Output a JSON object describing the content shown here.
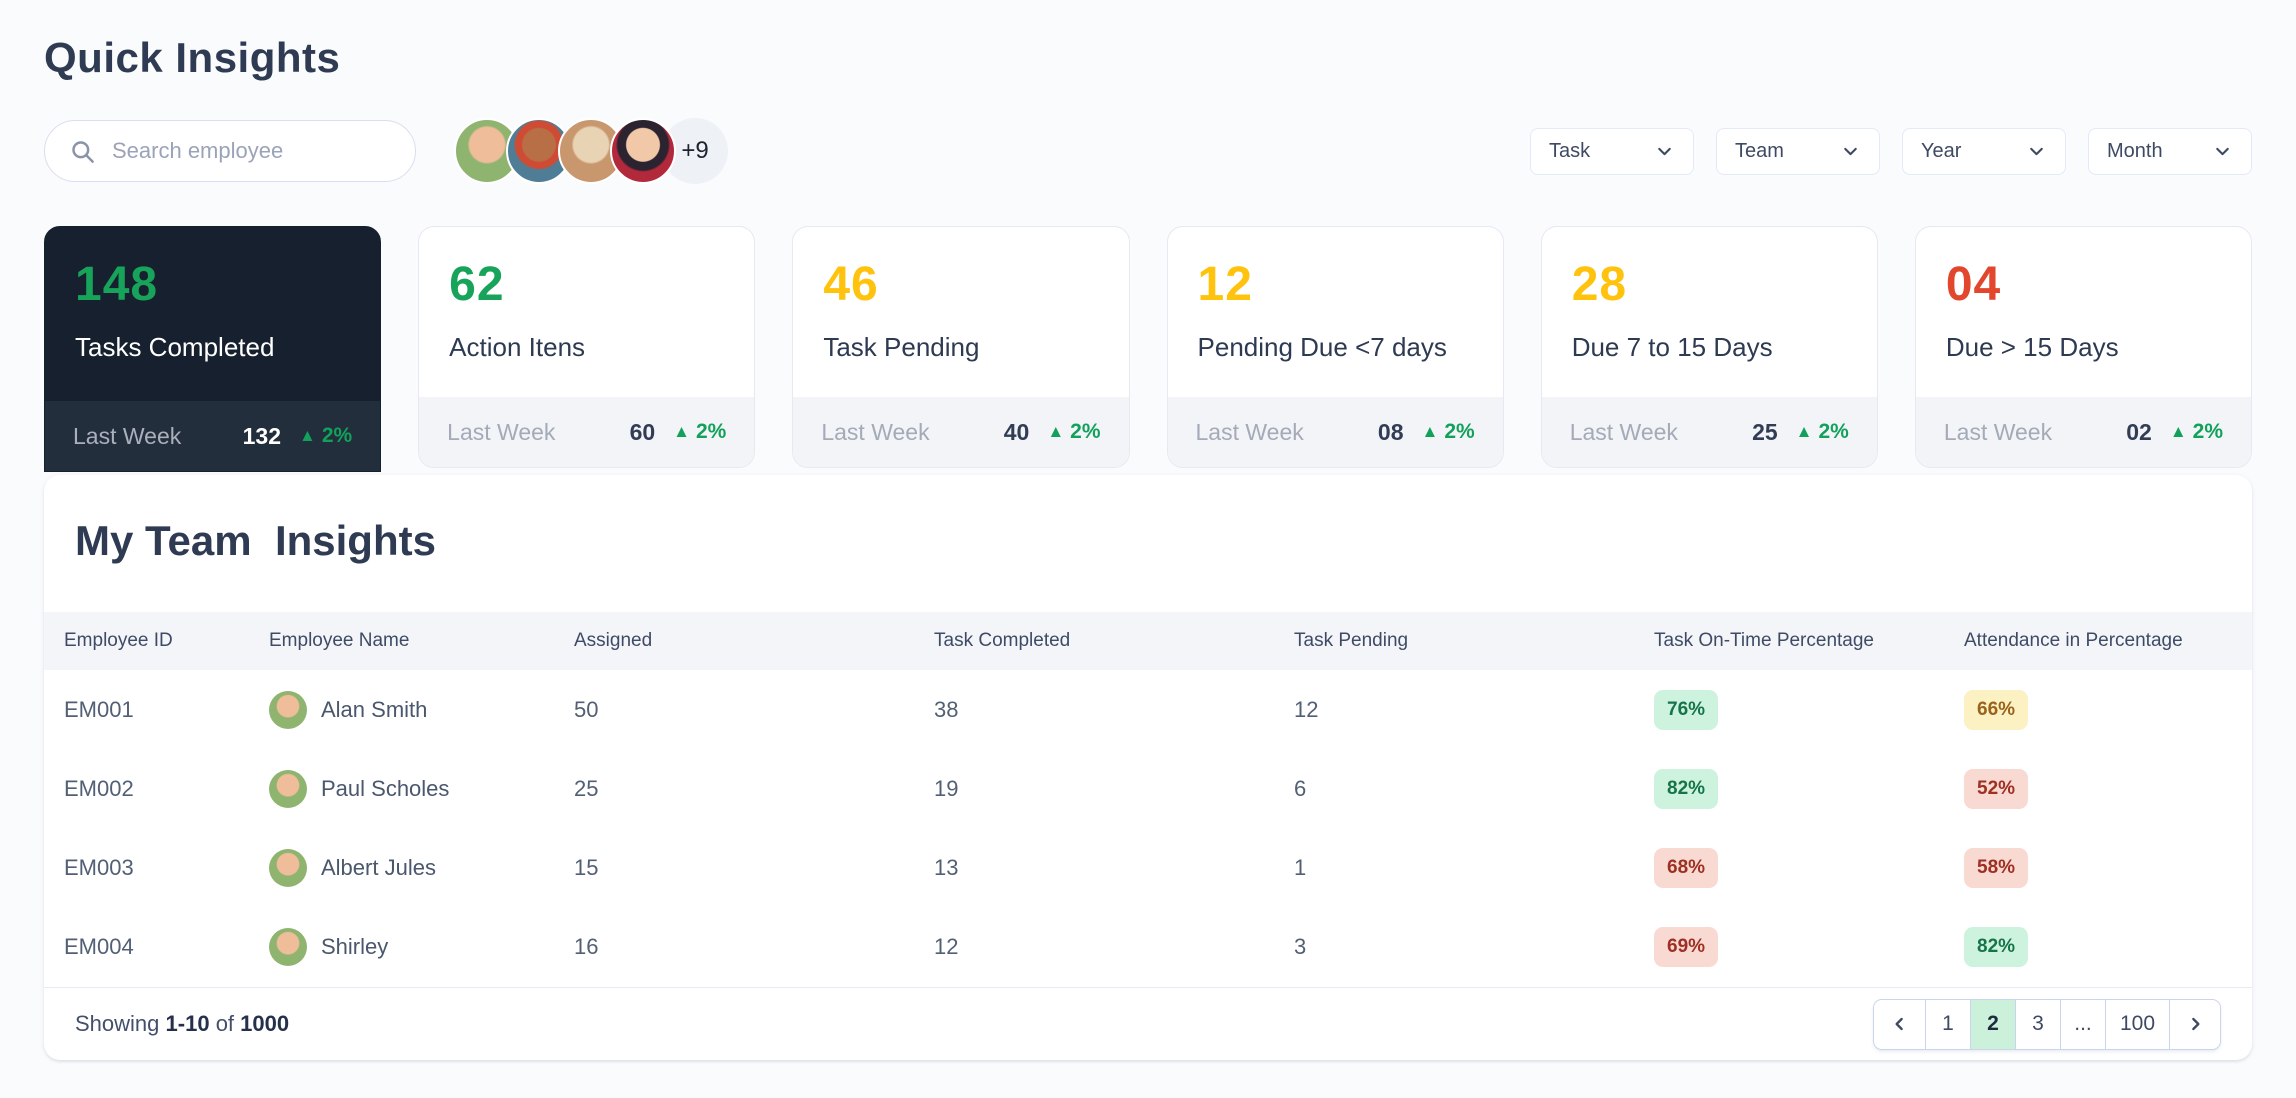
{
  "page": {
    "title": "Quick Insights"
  },
  "search": {
    "placeholder": "Search employee"
  },
  "avatars": {
    "overflow_label": "+9",
    "visible_count": 4
  },
  "filters": [
    {
      "label": "Task"
    },
    {
      "label": "Team"
    },
    {
      "label": "Year"
    },
    {
      "label": "Month"
    }
  ],
  "cards": [
    {
      "value": "148",
      "label": "Tasks Completed",
      "value_color": "green",
      "variant": "dark",
      "last_week_label": "Last Week",
      "last_value": "132",
      "delta": "2%"
    },
    {
      "value": "62",
      "label": "Action Itens",
      "value_color": "green",
      "variant": "light",
      "last_week_label": "Last Week",
      "last_value": "60",
      "delta": "2%"
    },
    {
      "value": "46",
      "label": "Task Pending",
      "value_color": "amber",
      "variant": "light",
      "last_week_label": "Last Week",
      "last_value": "40",
      "delta": "2%"
    },
    {
      "value": "12",
      "label": "Pending Due <7 days",
      "value_color": "amber",
      "variant": "light",
      "last_week_label": "Last Week",
      "last_value": "08",
      "delta": "2%"
    },
    {
      "value": "28",
      "label": "Due 7 to 15 Days",
      "value_color": "amber",
      "variant": "light",
      "last_week_label": "Last Week",
      "last_value": "25",
      "delta": "2%"
    },
    {
      "value": "04",
      "label": "Due > 15 Days",
      "value_color": "red",
      "variant": "light",
      "last_week_label": "Last Week",
      "last_value": "02",
      "delta": "2%"
    }
  ],
  "up_arrow_glyph": "▲",
  "team": {
    "title": "My Team  Insights",
    "columns": [
      "Employee ID",
      "Employee Name",
      "Assigned",
      "Task Completed",
      "Task Pending",
      "Task On-Time Percentage",
      "Attendance in Percentage"
    ],
    "rows": [
      {
        "id": "EM001",
        "name": "Alan Smith",
        "assigned": "50",
        "completed": "38",
        "pending": "12",
        "on_time": "76%",
        "on_time_tone": "green",
        "attendance": "66%",
        "attendance_tone": "yellow"
      },
      {
        "id": "EM002",
        "name": "Paul Scholes",
        "assigned": "25",
        "completed": "19",
        "pending": "6",
        "on_time": "82%",
        "on_time_tone": "green",
        "attendance": "52%",
        "attendance_tone": "red"
      },
      {
        "id": "EM003",
        "name": "Albert Jules",
        "assigned": "15",
        "completed": "13",
        "pending": "1",
        "on_time": "68%",
        "on_time_tone": "red",
        "attendance": "58%",
        "attendance_tone": "red"
      },
      {
        "id": "EM004",
        "name": "Shirley",
        "assigned": "16",
        "completed": "12",
        "pending": "3",
        "on_time": "69%",
        "on_time_tone": "red",
        "attendance": "82%",
        "attendance_tone": "green"
      }
    ]
  },
  "footer": {
    "showing_prefix": "Showing",
    "range": "1-10",
    "of_word": "of",
    "total": "1000",
    "pagination": {
      "pages": [
        "1",
        "2",
        "3",
        "...",
        "100"
      ],
      "active": "2"
    }
  },
  "colors": {
    "accent_green": "#12a15b",
    "amber": "#ffc20d",
    "red": "#e2472d",
    "dark_card_bg": "#16202e",
    "active_page_bg": "#cbf1db"
  }
}
